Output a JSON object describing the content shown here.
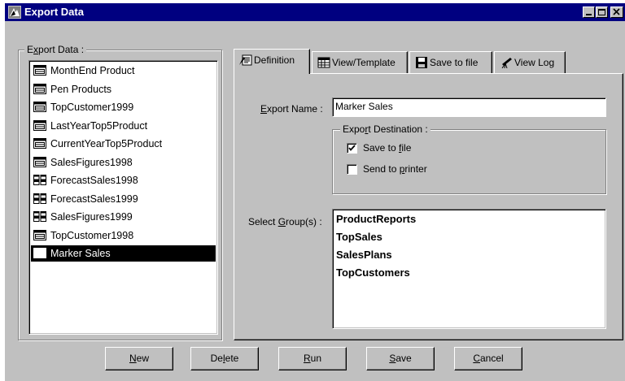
{
  "window": {
    "title": "Export Data",
    "controls": [
      "minimize-icon",
      "maximize-icon",
      "close-icon"
    ]
  },
  "export_list": {
    "label_prefix": "E",
    "label_underline": "x",
    "label_rest": "port Data :",
    "items": [
      {
        "label": "MonthEnd Product",
        "icon": "table-icon",
        "selected": false
      },
      {
        "label": "Pen Products",
        "icon": "table-icon",
        "selected": false
      },
      {
        "label": "TopCustomer1999",
        "icon": "table-icon",
        "selected": false
      },
      {
        "label": "LastYearTop5Product",
        "icon": "table-icon",
        "selected": false
      },
      {
        "label": "CurrentYearTop5Product",
        "icon": "table-icon",
        "selected": false
      },
      {
        "label": "SalesFigures1998",
        "icon": "table-icon",
        "selected": false
      },
      {
        "label": "ForecastSales1998",
        "icon": "grid-icon",
        "selected": false
      },
      {
        "label": "ForecastSales1999",
        "icon": "grid-icon",
        "selected": false
      },
      {
        "label": "SalesFigures1999",
        "icon": "grid-icon",
        "selected": false
      },
      {
        "label": "TopCustomer1998",
        "icon": "table-icon",
        "selected": false
      },
      {
        "label": "Marker Sales",
        "icon": "table-icon",
        "selected": true
      }
    ]
  },
  "tabs": [
    {
      "label": "Definition",
      "icon": "definition-icon",
      "active": true
    },
    {
      "label": "View/Template",
      "icon": "view-template-icon",
      "active": false
    },
    {
      "label": "Save to file",
      "icon": "floppy-disk-icon",
      "active": false
    },
    {
      "label": "View Log",
      "icon": "telescope-icon",
      "active": false
    }
  ],
  "definition": {
    "export_name_label_u": "E",
    "export_name_label_rest": "xport Name :",
    "export_name_value": "Marker Sales",
    "destination_label_a": "Expo",
    "destination_label_u": "r",
    "destination_label_b": "t Destination :",
    "save_to_file_a": "Save to ",
    "save_to_file_u": "f",
    "save_to_file_b": "ile",
    "save_to_file_checked": true,
    "send_to_printer_a": "Send to ",
    "send_to_printer_u": "p",
    "send_to_printer_b": "rinter",
    "send_to_printer_checked": false,
    "select_groups_label_a": "Select ",
    "select_groups_label_u": "G",
    "select_groups_label_b": "roup(s) :",
    "groups": [
      "ProductReports",
      "TopSales",
      "SalesPlans",
      "TopCustomers"
    ]
  },
  "buttons": {
    "new_u": "N",
    "new_rest": "ew",
    "delete_a": "De",
    "delete_u": "l",
    "delete_b": "ete",
    "run_u": "R",
    "run_rest": "un",
    "save_u": "S",
    "save_rest": "ave",
    "cancel_u": "C",
    "cancel_rest": "ancel"
  }
}
